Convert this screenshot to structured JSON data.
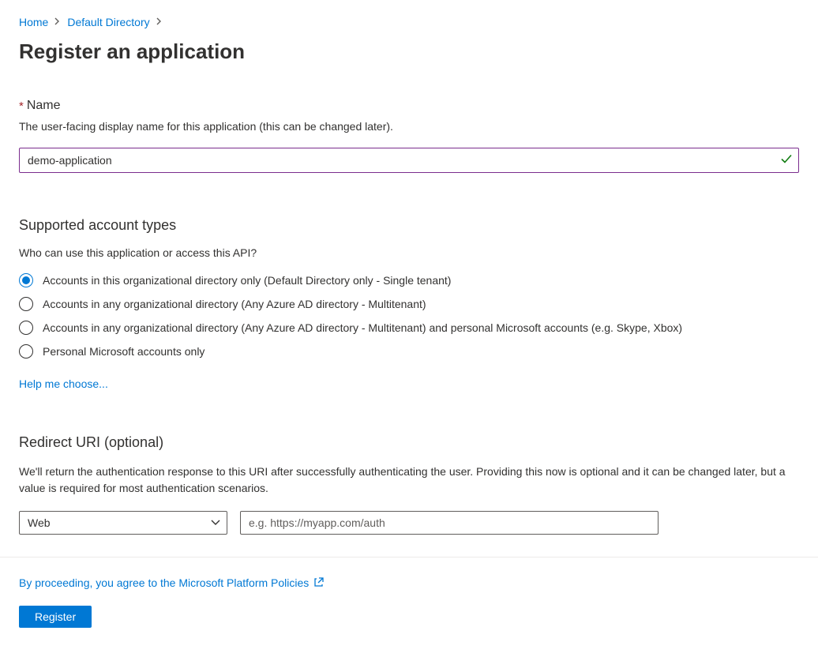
{
  "breadcrumb": {
    "items": [
      {
        "label": "Home"
      },
      {
        "label": "Default Directory"
      }
    ]
  },
  "page": {
    "title": "Register an application"
  },
  "name_section": {
    "label": "Name",
    "required_mark": "*",
    "help": "The user-facing display name for this application (this can be changed later).",
    "value": "demo-application"
  },
  "account_types": {
    "heading": "Supported account types",
    "question": "Who can use this application or access this API?",
    "options": [
      {
        "label": "Accounts in this organizational directory only (Default Directory only - Single tenant)",
        "selected": true
      },
      {
        "label": "Accounts in any organizational directory (Any Azure AD directory - Multitenant)",
        "selected": false
      },
      {
        "label": "Accounts in any organizational directory (Any Azure AD directory - Multitenant) and personal Microsoft accounts (e.g. Skype, Xbox)",
        "selected": false
      },
      {
        "label": "Personal Microsoft accounts only",
        "selected": false
      }
    ],
    "help_link": "Help me choose..."
  },
  "redirect": {
    "heading": "Redirect URI (optional)",
    "description": "We'll return the authentication response to this URI after successfully authenticating the user. Providing this now is optional and it can be changed later, but a value is required for most authentication scenarios.",
    "platform_selected": "Web",
    "uri_placeholder": "e.g. https://myapp.com/auth"
  },
  "footer": {
    "policies_text": "By proceeding, you agree to the Microsoft Platform Policies",
    "register_label": "Register"
  }
}
